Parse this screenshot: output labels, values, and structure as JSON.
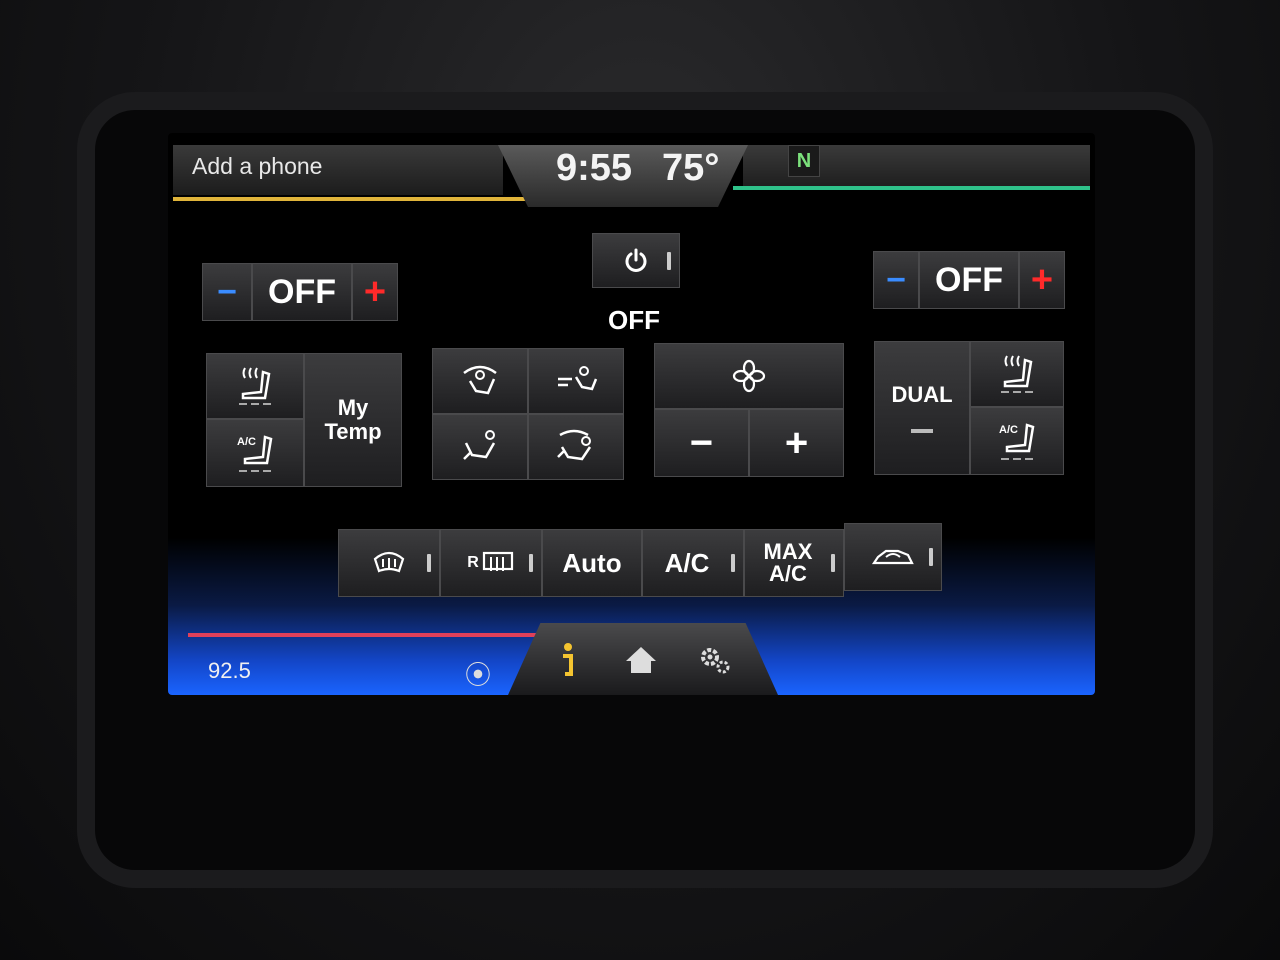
{
  "status": {
    "phone_label": "Add a phone",
    "time": "9:55",
    "outside_temp": "75°",
    "compass": "N"
  },
  "climate": {
    "left_temp": {
      "minus": "−",
      "value": "OFF",
      "plus": "+"
    },
    "right_temp": {
      "minus": "−",
      "value": "OFF",
      "plus": "+"
    },
    "power_status": "OFF",
    "power_icon": "power-icon",
    "left_seat": {
      "heat_icon": "seat-heat-icon",
      "cool_icon": "seat-ac-icon",
      "cool_label": "A/C"
    },
    "my_temp_label": "My\nTemp",
    "airflow": [
      "airflow-windshield-icon",
      "airflow-face-icon",
      "airflow-floor-icon",
      "airflow-face-floor-icon"
    ],
    "fan": {
      "icon": "fan-icon",
      "minus": "−",
      "plus": "+"
    },
    "dual_label": "DUAL",
    "right_seat": {
      "heat_icon": "seat-heat-icon",
      "cool_icon": "seat-ac-icon",
      "cool_label": "A/C"
    },
    "bottom_buttons": {
      "defrost_icon": "front-defrost-icon",
      "rear_label": "R",
      "rear_icon": "rear-defrost-icon",
      "auto": "Auto",
      "ac": "A/C",
      "max_ac_1": "MAX",
      "max_ac_2": "A/C",
      "recirc_icon": "recirculate-icon"
    }
  },
  "footer": {
    "radio_freq": "92.5",
    "radio_icon": "radio-signal-icon",
    "info_icon": "info-icon",
    "home_icon": "home-icon",
    "settings_icon": "settings-icon"
  },
  "colors": {
    "minus_blue": "#3a8cff",
    "plus_red": "#ff2a2a",
    "info_yellow": "#f4c430",
    "accent_green": "#2fc28a",
    "accent_yellow": "#e0b43a",
    "accent_red": "#e0405a"
  }
}
